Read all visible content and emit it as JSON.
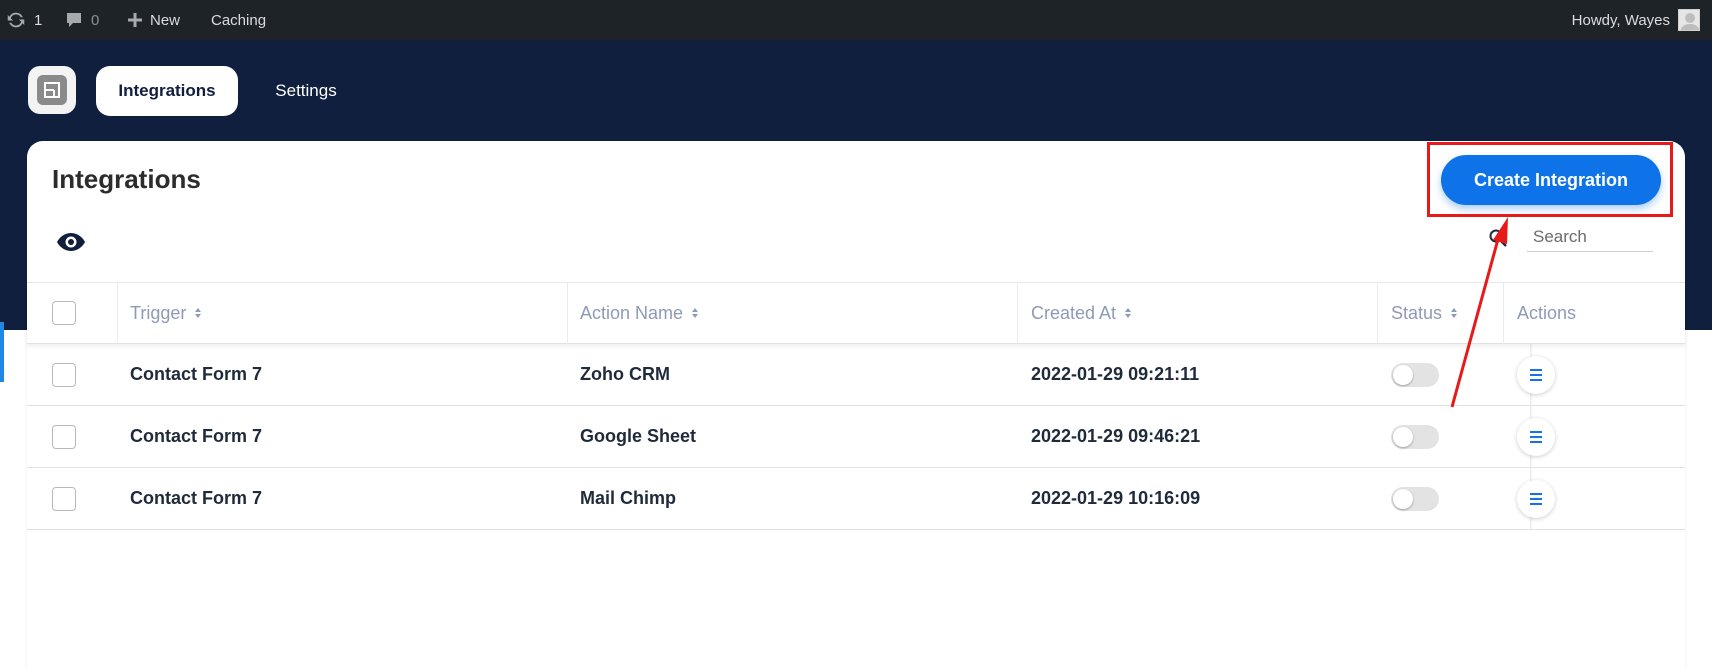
{
  "admin_bar": {
    "updates_count": "1",
    "comments_count": "0",
    "new_label": "New",
    "caching_label": "Caching",
    "howdy_label": "Howdy, Wayes"
  },
  "nav": {
    "tabs": [
      {
        "label": "Integrations",
        "active": true
      },
      {
        "label": "Settings",
        "active": false
      }
    ]
  },
  "main": {
    "title": "Integrations",
    "create_button_label": "Create Integration",
    "search_placeholder": "Search"
  },
  "table": {
    "columns": [
      "Trigger",
      "Action Name",
      "Created At",
      "Status",
      "Actions"
    ],
    "rows": [
      {
        "trigger": "Contact Form 7",
        "action": "Zoho CRM",
        "created_at": "2022-01-29 09:21:11",
        "status": false
      },
      {
        "trigger": "Contact Form 7",
        "action": "Google Sheet",
        "created_at": "2022-01-29 09:46:21",
        "status": false
      },
      {
        "trigger": "Contact Form 7",
        "action": "Mail Chimp",
        "created_at": "2022-01-29 10:16:09",
        "status": false
      }
    ]
  },
  "colors": {
    "header_bg": "#0f1f3d",
    "accent": "#0e72e8",
    "highlight": "#e81919"
  }
}
